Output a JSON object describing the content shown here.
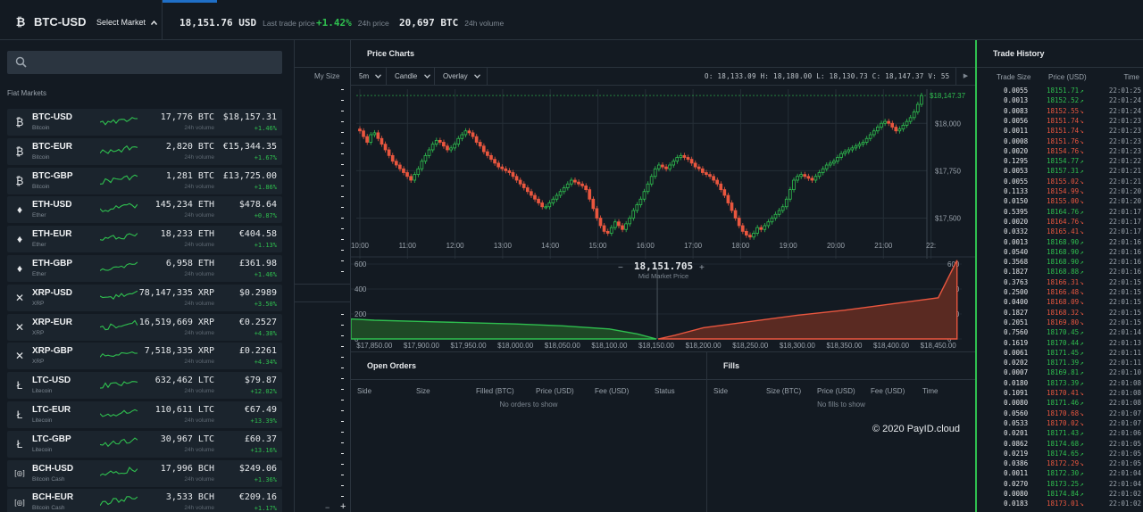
{
  "header": {
    "market": "BTC-USD",
    "coin_glyph": "₿",
    "select_market": "Select Market",
    "last_price": "18,151.76 USD",
    "last_price_label": "Last trade price",
    "change": "+1.42%",
    "change_label": "24h price",
    "volume": "20,697 BTC",
    "volume_label": "24h volume"
  },
  "search": {
    "placeholder": ""
  },
  "section_label": "Fiat Markets",
  "markets": [
    {
      "sym": "BTC-USD",
      "name": "Bitcoin",
      "glyph": "₿",
      "vol": "17,776 BTC",
      "price": "$18,157.31",
      "change": "+1.46%"
    },
    {
      "sym": "BTC-EUR",
      "name": "Bitcoin",
      "glyph": "₿",
      "vol": "2,820 BTC",
      "price": "€15,344.35",
      "change": "+1.67%"
    },
    {
      "sym": "BTC-GBP",
      "name": "Bitcoin",
      "glyph": "₿",
      "vol": "1,281 BTC",
      "price": "£13,725.00",
      "change": "+1.86%"
    },
    {
      "sym": "ETH-USD",
      "name": "Ether",
      "glyph": "♦",
      "vol": "145,234 ETH",
      "price": "$478.64",
      "change": "+0.87%"
    },
    {
      "sym": "ETH-EUR",
      "name": "Ether",
      "glyph": "♦",
      "vol": "18,233 ETH",
      "price": "€404.58",
      "change": "+1.13%"
    },
    {
      "sym": "ETH-GBP",
      "name": "Ether",
      "glyph": "♦",
      "vol": "6,958 ETH",
      "price": "£361.98",
      "change": "+1.46%"
    },
    {
      "sym": "XRP-USD",
      "name": "XRP",
      "glyph": "✕",
      "vol": "78,147,335 XRP",
      "price": "$0.2989",
      "change": "+3.50%"
    },
    {
      "sym": "XRP-EUR",
      "name": "XRP",
      "glyph": "✕",
      "vol": "16,519,669 XRP",
      "price": "€0.2527",
      "change": "+4.38%"
    },
    {
      "sym": "XRP-GBP",
      "name": "XRP",
      "glyph": "✕",
      "vol": "7,518,335 XRP",
      "price": "£0.2261",
      "change": "+4.34%"
    },
    {
      "sym": "LTC-USD",
      "name": "Litecoin",
      "glyph": "Ł",
      "vol": "632,462 LTC",
      "price": "$79.87",
      "change": "+12.02%"
    },
    {
      "sym": "LTC-EUR",
      "name": "Litecoin",
      "glyph": "Ł",
      "vol": "110,611 LTC",
      "price": "€67.49",
      "change": "+13.39%"
    },
    {
      "sym": "LTC-GBP",
      "name": "Litecoin",
      "glyph": "Ł",
      "vol": "30,967 LTC",
      "price": "£60.37",
      "change": "+13.16%"
    },
    {
      "sym": "BCH-USD",
      "name": "Bitcoin Cash",
      "glyph": "[◎]",
      "vol": "17,996 BCH",
      "price": "$249.06",
      "change": "+1.36%"
    },
    {
      "sym": "BCH-EUR",
      "name": "Bitcoin Cash",
      "glyph": "[◎]",
      "vol": "3,533 BCH",
      "price": "€209.16",
      "change": "+1.17%"
    }
  ],
  "vol_label": "24h volume",
  "ladder": {
    "my_size": "My Size",
    "minus": "−",
    "plus": "+"
  },
  "chart": {
    "title": "Price Charts",
    "granularity": "5m",
    "type": "Candle",
    "overlay": "Overlay",
    "ohlc": "O: 18,133.09  H: 18,180.00  L: 18,130.73  C: 18,147.37  V:     55",
    "play": "▶"
  },
  "chart_data": [
    {
      "type": "candlestick",
      "x_ticks": [
        "10:00",
        "11:00",
        "12:00",
        "13:00",
        "14:00",
        "15:00",
        "16:00",
        "17:00",
        "18:00",
        "19:00",
        "20:00",
        "21:00",
        "22:"
      ],
      "y_ticks": [
        "$18,000",
        "$17,750",
        "$17,500"
      ],
      "ylim": [
        17380,
        18180
      ],
      "last_price_label": "$18,147.37",
      "closes": [
        17960,
        17930,
        17900,
        17940,
        17950,
        17920,
        17890,
        17860,
        17830,
        17800,
        17780,
        17760,
        17740,
        17720,
        17700,
        17730,
        17760,
        17800,
        17830,
        17860,
        17890,
        17910,
        17900,
        17880,
        17860,
        17870,
        17890,
        17920,
        17940,
        17960,
        17950,
        17930,
        17900,
        17880,
        17850,
        17830,
        17810,
        17790,
        17770,
        17760,
        17750,
        17740,
        17720,
        17700,
        17680,
        17660,
        17640,
        17620,
        17600,
        17580,
        17560,
        17560,
        17580,
        17600,
        17620,
        17640,
        17660,
        17680,
        17700,
        17690,
        17680,
        17670,
        17650,
        17600,
        17550,
        17500,
        17460,
        17430,
        17420,
        17450,
        17480,
        17460,
        17440,
        17470,
        17500,
        17540,
        17570,
        17600,
        17640,
        17680,
        17720,
        17760,
        17780,
        17770,
        17760,
        17780,
        17800,
        17820,
        17830,
        17820,
        17810,
        17790,
        17770,
        17760,
        17740,
        17730,
        17720,
        17700,
        17680,
        17650,
        17620,
        17580,
        17540,
        17500,
        17460,
        17430,
        17410,
        17400,
        17420,
        17450,
        17440,
        17460,
        17480,
        17500,
        17520,
        17540,
        17560,
        17600,
        17650,
        17700,
        17720,
        17730,
        17720,
        17710,
        17700,
        17720,
        17740,
        17760,
        17780,
        17790,
        17800,
        17820,
        17840,
        17850,
        17860,
        17870,
        17880,
        17890,
        17900,
        17920,
        17940,
        17960,
        17980,
        18000,
        18010,
        18000,
        17980,
        17960,
        17970,
        17990,
        18010,
        18030,
        18060,
        18100,
        18147
      ]
    },
    {
      "type": "area",
      "title": "Mid Market Price",
      "mid_price": "18,151.705",
      "x_ticks": [
        "$17,850.00",
        "$17,900.00",
        "$17,950.00",
        "$18,000.00",
        "$18,050.00",
        "$18,100.00",
        "$18,150.00",
        "$18,200.00",
        "$18,250.00",
        "$18,300.00",
        "$18,350.00",
        "$18,400.00",
        "$18,450.00"
      ],
      "y_ticks": [
        "600",
        "400",
        "200",
        "0"
      ],
      "ylim": [
        0,
        600
      ],
      "series": [
        {
          "name": "bids",
          "x": [
            17825,
            17850,
            17900,
            17950,
            18000,
            18050,
            18100,
            18130,
            18150
          ],
          "values": [
            160,
            150,
            140,
            130,
            120,
            105,
            80,
            40,
            0
          ]
        },
        {
          "name": "asks",
          "x": [
            18152,
            18170,
            18200,
            18250,
            18300,
            18350,
            18400,
            18450,
            18470
          ],
          "values": [
            0,
            30,
            90,
            140,
            190,
            230,
            280,
            330,
            630
          ]
        }
      ]
    }
  ],
  "open_orders": {
    "title": "Open Orders",
    "cols": [
      "Side",
      "Size",
      "Filled (BTC)",
      "Price (USD)",
      "Fee (USD)",
      "Status"
    ],
    "empty": "No orders to show"
  },
  "fills": {
    "title": "Fills",
    "cols": [
      "Side",
      "Size (BTC)",
      "Price (USD)",
      "Fee (USD)",
      "Time"
    ],
    "empty": "No fills to show"
  },
  "watermark": "© 2020 PayID.cloud",
  "trade_history": {
    "title": "Trade History",
    "cols": [
      "Trade Size",
      "Price (USD)",
      "Time"
    ],
    "rows": [
      [
        "0.0055",
        "18151.71",
        "22:01:25",
        "up"
      ],
      [
        "0.0013",
        "18152.52",
        "22:01:24",
        "up"
      ],
      [
        "0.0083",
        "18152.55",
        "22:01:24",
        "down"
      ],
      [
        "0.0056",
        "18151.74",
        "22:01:23",
        "down"
      ],
      [
        "0.0011",
        "18151.74",
        "22:01:23",
        "down"
      ],
      [
        "0.0008",
        "18151.76",
        "22:01:23",
        "down"
      ],
      [
        "0.0020",
        "18154.76",
        "22:01:23",
        "down"
      ],
      [
        "0.1295",
        "18154.77",
        "22:01:22",
        "up"
      ],
      [
        "0.0053",
        "18157.31",
        "22:01:21",
        "up"
      ],
      [
        "0.0055",
        "18155.02",
        "22:01:21",
        "down"
      ],
      [
        "0.1133",
        "18154.99",
        "22:01:20",
        "down"
      ],
      [
        "0.0150",
        "18155.00",
        "22:01:20",
        "down"
      ],
      [
        "0.5395",
        "18164.76",
        "22:01:17",
        "up"
      ],
      [
        "0.0020",
        "18164.76",
        "22:01:17",
        "down"
      ],
      [
        "0.0332",
        "18165.41",
        "22:01:17",
        "down"
      ],
      [
        "0.0013",
        "18168.90",
        "22:01:16",
        "up"
      ],
      [
        "0.0540",
        "18168.90",
        "22:01:16",
        "up"
      ],
      [
        "0.3568",
        "18168.90",
        "22:01:16",
        "up"
      ],
      [
        "0.1827",
        "18168.88",
        "22:01:16",
        "up"
      ],
      [
        "0.3763",
        "18166.31",
        "22:01:15",
        "down"
      ],
      [
        "0.2500",
        "18166.48",
        "22:01:15",
        "down"
      ],
      [
        "0.0400",
        "18168.09",
        "22:01:15",
        "down"
      ],
      [
        "0.1827",
        "18168.32",
        "22:01:15",
        "down"
      ],
      [
        "0.2051",
        "18169.80",
        "22:01:15",
        "down"
      ],
      [
        "0.7560",
        "18170.45",
        "22:01:14",
        "up"
      ],
      [
        "0.1619",
        "18170.44",
        "22:01:13",
        "up"
      ],
      [
        "0.0061",
        "18171.45",
        "22:01:11",
        "up"
      ],
      [
        "0.0202",
        "18171.39",
        "22:01:11",
        "up"
      ],
      [
        "0.0007",
        "18169.81",
        "22:01:10",
        "up"
      ],
      [
        "0.0180",
        "18173.39",
        "22:01:08",
        "up"
      ],
      [
        "0.1091",
        "18170.41",
        "22:01:08",
        "down"
      ],
      [
        "0.0080",
        "18171.46",
        "22:01:08",
        "up"
      ],
      [
        "0.0560",
        "18170.68",
        "22:01:07",
        "down"
      ],
      [
        "0.0533",
        "18170.02",
        "22:01:07",
        "down"
      ],
      [
        "0.0201",
        "18171.43",
        "22:01:06",
        "up"
      ],
      [
        "0.0862",
        "18174.68",
        "22:01:05",
        "up"
      ],
      [
        "0.0219",
        "18174.65",
        "22:01:05",
        "up"
      ],
      [
        "0.0386",
        "18172.29",
        "22:01:05",
        "down"
      ],
      [
        "0.0011",
        "18172.30",
        "22:01:04",
        "up"
      ],
      [
        "0.0270",
        "18173.25",
        "22:01:04",
        "up"
      ],
      [
        "0.0080",
        "18174.84",
        "22:01:02",
        "up"
      ],
      [
        "0.0183",
        "18173.01",
        "22:01:02",
        "down"
      ]
    ]
  },
  "colors": {
    "up": "#2fbf4f",
    "down": "#e9563f",
    "bg": "#131a22",
    "row": "#1b242d",
    "accent": "#1f6fc7"
  }
}
